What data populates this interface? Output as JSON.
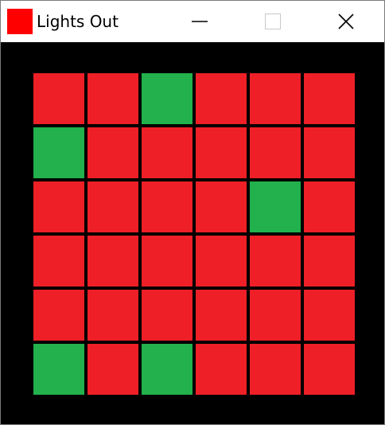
{
  "window": {
    "title": "Lights Out",
    "icon": "red-square-app-icon"
  },
  "controls": {
    "minimize_icon": "minimize-icon",
    "maximize_icon": "maximize-icon",
    "close_icon": "close-icon"
  },
  "colors": {
    "on": "#ee1f27",
    "off": "#22b14c",
    "app_icon": "#ff0000",
    "background": "#000000",
    "titlebar": "#ffffff"
  },
  "board": {
    "rows": 6,
    "cols": 6,
    "cells": [
      [
        "on",
        "on",
        "off",
        "on",
        "on",
        "on"
      ],
      [
        "off",
        "on",
        "on",
        "on",
        "on",
        "on"
      ],
      [
        "on",
        "on",
        "on",
        "on",
        "off",
        "on"
      ],
      [
        "on",
        "on",
        "on",
        "on",
        "on",
        "on"
      ],
      [
        "on",
        "on",
        "on",
        "on",
        "on",
        "on"
      ],
      [
        "off",
        "on",
        "off",
        "on",
        "on",
        "on"
      ]
    ]
  }
}
